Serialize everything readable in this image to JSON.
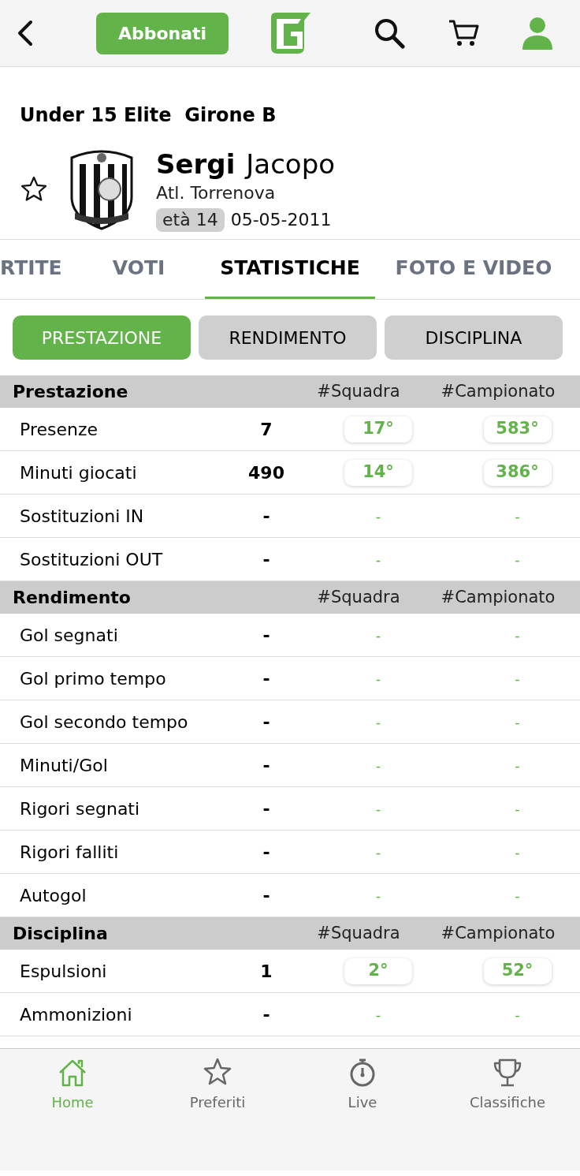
{
  "header": {
    "subscribe_button": "Abbonati"
  },
  "competition": "Under 15 Elite  Girone B",
  "player": {
    "surname": "Sergi",
    "name": "Jacopo",
    "club": "Atl. Torrenova",
    "age": "età 14",
    "birth_date": "05-05-2011",
    "favorite": false
  },
  "tabs": [
    {
      "label": "RTITE",
      "selected": false
    },
    {
      "label": "VOTI",
      "selected": false
    },
    {
      "label": "STATISTICHE",
      "selected": true
    },
    {
      "label": "FOTO E VIDEO",
      "selected": false
    }
  ],
  "filters": [
    {
      "label": "PRESTAZIONE",
      "selected": true
    },
    {
      "label": "RENDIMENTO",
      "selected": false
    },
    {
      "label": "DISCIPLINA",
      "selected": false
    }
  ],
  "sections": [
    {
      "title": "Prestazione",
      "team_header": "#Squadra",
      "league_header": "#Campionato",
      "rows": [
        {
          "label": "Presenze",
          "value": "7",
          "team_rank": "17°",
          "league_rank": "583°",
          "ranked": true
        },
        {
          "label": "Minuti giocati",
          "value": "490",
          "team_rank": "14°",
          "league_rank": "386°",
          "ranked": true
        },
        {
          "label": "Sostituzioni IN",
          "value": "-",
          "team_rank": "-",
          "league_rank": "-",
          "ranked": false
        },
        {
          "label": "Sostituzioni OUT",
          "value": "-",
          "team_rank": "-",
          "league_rank": "-",
          "ranked": false
        }
      ]
    },
    {
      "title": "Rendimento",
      "team_header": "#Squadra",
      "league_header": "#Campionato",
      "rows": [
        {
          "label": "Gol segnati",
          "value": "-",
          "team_rank": "-",
          "league_rank": "-",
          "ranked": false
        },
        {
          "label": "Gol primo tempo",
          "value": "-",
          "team_rank": "-",
          "league_rank": "-",
          "ranked": false
        },
        {
          "label": "Gol secondo tempo",
          "value": "-",
          "team_rank": "-",
          "league_rank": "-",
          "ranked": false
        },
        {
          "label": "Minuti/Gol",
          "value": "-",
          "team_rank": "-",
          "league_rank": "-",
          "ranked": false
        },
        {
          "label": "Rigori segnati",
          "value": "-",
          "team_rank": "-",
          "league_rank": "-",
          "ranked": false
        },
        {
          "label": "Rigori falliti",
          "value": "-",
          "team_rank": "-",
          "league_rank": "-",
          "ranked": false
        },
        {
          "label": "Autogol",
          "value": "-",
          "team_rank": "-",
          "league_rank": "-",
          "ranked": false
        }
      ]
    },
    {
      "title": "Disciplina",
      "team_header": "#Squadra",
      "league_header": "#Campionato",
      "rows": [
        {
          "label": "Espulsioni",
          "value": "1",
          "team_rank": "2°",
          "league_rank": "52°",
          "ranked": true
        },
        {
          "label": "Ammonizioni",
          "value": "-",
          "team_rank": "-",
          "league_rank": "-",
          "ranked": false
        }
      ]
    }
  ],
  "bottom_nav": [
    {
      "label": "Home",
      "kind": "home",
      "selected": true
    },
    {
      "label": "Preferiti",
      "kind": "star",
      "selected": false
    },
    {
      "label": "Live",
      "kind": "stopwatch",
      "selected": false
    },
    {
      "label": "Classifiche",
      "kind": "trophy",
      "selected": false
    }
  ]
}
